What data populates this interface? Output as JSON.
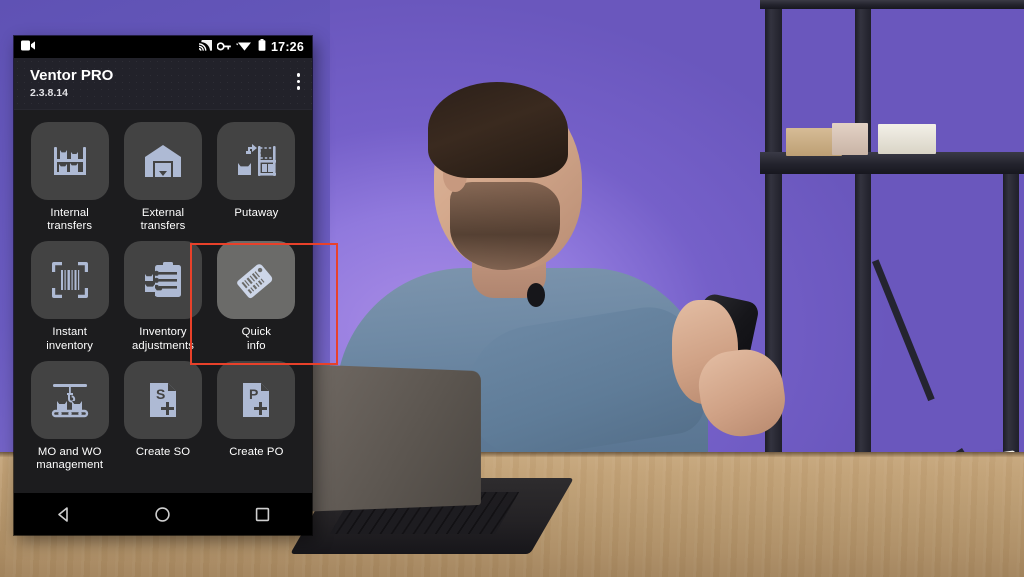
{
  "phone": {
    "statusbar": {
      "icons": [
        "screen-record-icon",
        "cast-icon",
        "vpn-key-icon",
        "wifi-icon",
        "battery-icon"
      ],
      "time": "17:26"
    },
    "appbar": {
      "title": "Ventor PRO",
      "version": "2.3.8.14",
      "overflow_menu": "overflow-menu-icon"
    },
    "grid": [
      {
        "id": "internal-transfers",
        "label": "Internal\ntransfers",
        "icon": "shelf-boxes-icon",
        "highlighted": false
      },
      {
        "id": "external-transfers",
        "label": "External\ntransfers",
        "icon": "warehouse-arrow-down-icon",
        "highlighted": false
      },
      {
        "id": "putaway",
        "label": "Putaway",
        "icon": "putaway-box-shelf-icon",
        "highlighted": false
      },
      {
        "id": "instant-inventory",
        "label": "Instant\ninventory",
        "icon": "barcode-scan-frame-icon",
        "highlighted": false
      },
      {
        "id": "inventory-adjustments",
        "label": "Inventory\nadjustments",
        "icon": "clipboard-checklist-icon",
        "highlighted": false
      },
      {
        "id": "quick-info",
        "label": "Quick\ninfo",
        "icon": "price-tag-barcode-icon",
        "highlighted": true
      },
      {
        "id": "mo-wo-management",
        "label": "MO and WO\nmanagement",
        "icon": "crane-conveyor-icon",
        "highlighted": false
      },
      {
        "id": "create-so",
        "label": "Create SO",
        "icon": "document-s-plus-icon",
        "highlighted": false
      },
      {
        "id": "create-po",
        "label": "Create PO",
        "icon": "document-p-plus-icon",
        "highlighted": false
      }
    ],
    "navbar": {
      "back": "back-triangle-icon",
      "home": "home-circle-icon",
      "recents": "recents-square-icon"
    }
  },
  "annotation": {
    "highlight_color": "#e8412a",
    "target": "quick-info"
  },
  "colors": {
    "tile": "#434343",
    "tile_highlight": "#6b6b69",
    "icon": "#aebad4",
    "screen_bg": "#1c1c1e",
    "appbar_bg": "#22222a",
    "accent_red": "#e8412a"
  }
}
